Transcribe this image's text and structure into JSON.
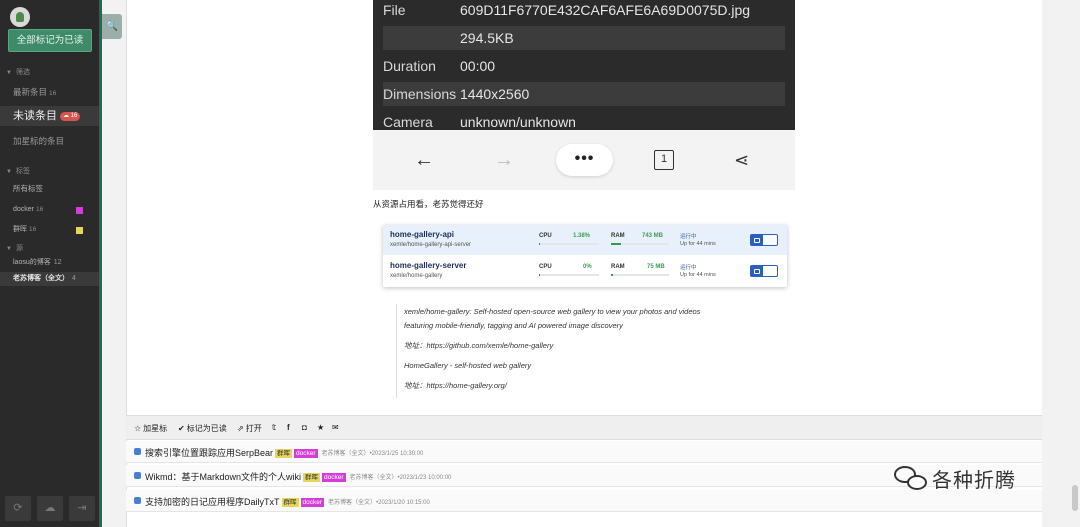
{
  "sidebar": {
    "mark_all_read": "全部标记为已读",
    "section_filter": "筛选",
    "latest": {
      "label": "最新条目",
      "count": "16"
    },
    "unread": {
      "label": "未读条目",
      "count": "16"
    },
    "starred": {
      "label": "加星标的条目"
    },
    "section_tags": "标签",
    "all_tags": "所有标签",
    "tags": [
      {
        "label": "docker",
        "count": "16",
        "color": "#d53cd8"
      },
      {
        "label": "群晖",
        "count": "16",
        "color": "#e5d55a"
      }
    ],
    "section_sources": "源",
    "feeds": [
      {
        "label": "laosu的博客",
        "count": "12"
      },
      {
        "label": "老苏博客（全文）",
        "count": "4"
      }
    ]
  },
  "article": {
    "info_rows": [
      {
        "key": "File",
        "value": "609D11F6770E432CAF6AFE6A69D0075D.jpg"
      },
      {
        "key": "",
        "value": "294.5KB"
      },
      {
        "key": "Duration",
        "value": "00:00"
      },
      {
        "key": "Dimensions",
        "value": "1440x2560"
      },
      {
        "key": "Camera",
        "value": "unknown/unknown"
      }
    ],
    "nav_page": "1",
    "paragraph": "从资源占用看，老苏觉得还好",
    "containers": [
      {
        "name": "home-gallery-api",
        "image": "xemle/home-gallery-api-server",
        "cpu_label": "CPU",
        "cpu": "1.38%",
        "cpu_fill": 0.02,
        "ram_label": "RAM",
        "ram": "743 MB",
        "ram_fill": 0.18,
        "status": "运行中",
        "uptime": "Up for 44 mins"
      },
      {
        "name": "home-gallery-server",
        "image": "xemle/home-gallery",
        "cpu_label": "CPU",
        "cpu": "0%",
        "cpu_fill": 0.0,
        "ram_label": "RAM",
        "ram": "75 MB",
        "ram_fill": 0.04,
        "status": "运行中",
        "uptime": "Up for 44 mins"
      }
    ],
    "quote": [
      "xemle/home-gallery: Self-hosted open-source web gallery to view your photos and videos",
      "featuring mobile-friendly, tagging and AI powered image discovery",
      "地址：https://github.com/xemle/home-gallery",
      "HomeGallery - self-hosted web gallery",
      "地址：https://home-gallery.org/"
    ]
  },
  "actions": {
    "star": "加星标",
    "mark_read": "标记为已读",
    "open": "打开"
  },
  "list": [
    {
      "title": "搜索引擎位置跟踪应用SerpBear",
      "tag1": "群晖",
      "tag2": "docker",
      "source": "老苏博客（全文）",
      "date": "•2023/1/25 10:30:00"
    },
    {
      "title": "Wikmd：基于Markdown文件的个人wiki",
      "tag1": "群晖",
      "tag2": "docker",
      "source": "老苏博客（全文）",
      "date": "•2023/1/23 10:00:00"
    },
    {
      "title": "支持加密的日记应用程序DailyTxT",
      "tag1": "群晖",
      "tag2": "docker",
      "source": "老苏博客（全文）",
      "date": "•2023/1/20 10:15:00"
    }
  ],
  "watermark": "各种折腾"
}
